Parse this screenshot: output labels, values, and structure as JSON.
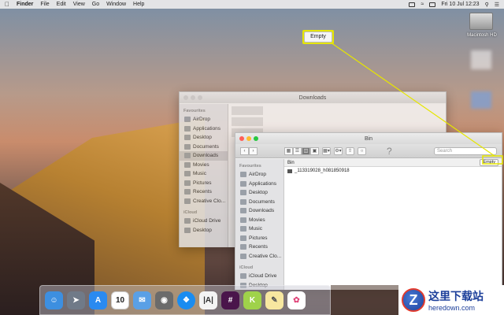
{
  "menubar": {
    "apple": "",
    "app": "Finder",
    "items": [
      "File",
      "Edit",
      "View",
      "Go",
      "Window",
      "Help"
    ],
    "clock": "Fri 10 Jul  12:23"
  },
  "desktop": {
    "hd_label": "Macintosh HD"
  },
  "callout": {
    "label": "Empty",
    "color": "#e6e600"
  },
  "back_window": {
    "title": "Downloads",
    "sidebar_heading": "Favourites",
    "items": [
      "AirDrop",
      "Applications",
      "Desktop",
      "Documents",
      "Downloads",
      "Movies",
      "Music",
      "Pictures",
      "Recents",
      "Creative Clo..."
    ],
    "selected": "Downloads",
    "icloud_heading": "iCloud",
    "icloud_items": [
      "iCloud Drive",
      "Desktop"
    ]
  },
  "front_window": {
    "title": "Bin",
    "search_placeholder": "Search",
    "help": "?",
    "sidebar_heading": "Favourites",
    "items": [
      "AirDrop",
      "Applications",
      "Desktop",
      "Documents",
      "Downloads",
      "Movies",
      "Music",
      "Pictures",
      "Recents",
      "Creative Clo..."
    ],
    "icloud_heading": "iCloud",
    "icloud_items": [
      "iCloud Drive",
      "Desktop"
    ],
    "path_label": "Bin",
    "empty_button": "Empty",
    "files": [
      "_113319028_h081850918"
    ]
  },
  "dock": {
    "icons": [
      "finder-icon",
      "launchpad-icon",
      "app-store-icon",
      "calendar-icon",
      "mail-icon",
      "preview-icon",
      "safari-icon",
      "text-editor-icon",
      "slack-icon",
      "keynote-icon",
      "notes-icon",
      "photos-icon"
    ],
    "calendar_day": "10",
    "colors": [
      "#3d8fe0",
      "#707a88",
      "#2a8af0",
      "#ffffff",
      "#5aa0e6",
      "#6b6b6b",
      "#1a8cf0",
      "#f4f4f4",
      "#4a154b",
      "#9fd24a",
      "#f7e7a0",
      "#ffffff"
    ]
  },
  "watermark": {
    "cn": "这里下载站",
    "en": "heredown.com"
  }
}
